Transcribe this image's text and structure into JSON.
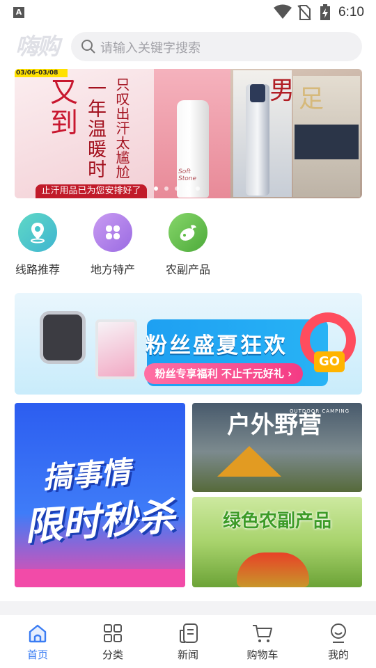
{
  "status_bar": {
    "time": "6:10",
    "notification_icon": "A",
    "icons": [
      "wifi-icon",
      "no-sim-icon",
      "battery-charging-icon"
    ]
  },
  "header": {
    "logo": "嗨购",
    "search_placeholder": "请输入关键字搜索"
  },
  "banner": {
    "date_tag": "03/06-03/08",
    "left_big": "又到",
    "left_line1": "一年温暖时",
    "left_line2": "只叹出汗太尴尬",
    "left_tag": "止汗用品已为您安排好了",
    "product_label": "Soft Stone",
    "right_text1": "男",
    "right_text2": "足",
    "active_slide": 0,
    "slide_count": 5
  },
  "categories": [
    {
      "label": "线路推荐",
      "icon": "location-pin-icon",
      "color": "#45c6cc"
    },
    {
      "label": "地方特产",
      "icon": "four-petal-icon",
      "color": "#b07fea"
    },
    {
      "label": "农副产品",
      "icon": "eggplant-icon",
      "color": "#5ebc44"
    }
  ],
  "promo": {
    "title": "粉丝盛夏狂欢",
    "button": "粉丝专享福利 不止千元好礼 ›",
    "go": "GO"
  },
  "tiles": {
    "flash_sale": {
      "line1": "搞事情",
      "line2": "限时秒杀"
    },
    "camping": {
      "title": "户外野营",
      "subtitle": "OUTDOOR CAMPING"
    },
    "produce": {
      "title": "绿色农副产品"
    }
  },
  "bottom_nav": [
    {
      "label": "首页",
      "icon": "home-icon",
      "active": true
    },
    {
      "label": "分类",
      "icon": "grid-icon",
      "active": false
    },
    {
      "label": "新闻",
      "icon": "news-icon",
      "active": false
    },
    {
      "label": "购物车",
      "icon": "cart-icon",
      "active": false
    },
    {
      "label": "我的",
      "icon": "profile-icon",
      "active": false
    }
  ],
  "colors": {
    "accent": "#3a7cf3",
    "search_bg": "#f1f1f3",
    "text": "#333333"
  }
}
